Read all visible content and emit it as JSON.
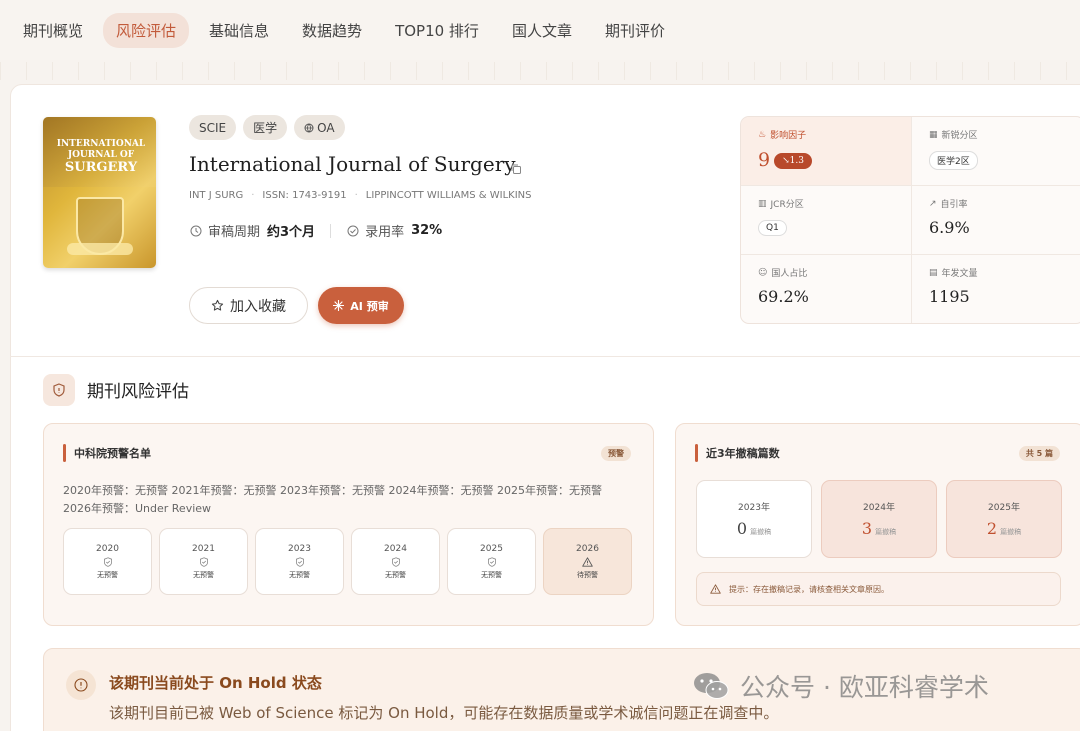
{
  "nav": {
    "tabs": [
      {
        "label": "期刊概览"
      },
      {
        "label": "风险评估"
      },
      {
        "label": "基础信息"
      },
      {
        "label": "数据趋势"
      },
      {
        "label": "TOP10 排行"
      },
      {
        "label": "国人文章"
      },
      {
        "label": "期刊评价"
      }
    ],
    "active_index": 1
  },
  "journal": {
    "cover": {
      "line1": "INTERNATIONAL",
      "line2": "JOURNAL OF",
      "line3": "SURGERY"
    },
    "tags": [
      "SCIE",
      "医学",
      "OA"
    ],
    "title": "International Journal of Surgery",
    "abbr": "INT J SURG",
    "issn": "ISSN: 1743-9191",
    "publisher": "LIPPINCOTT WILLIAMS & WILKINS",
    "review_label": "审稿周期",
    "review_value": "约3个月",
    "accept_label": "录用率",
    "accept_value": "32%",
    "fav_button": "加入收藏",
    "ai_button": "AI 预审"
  },
  "metrics": {
    "impact_label": "影响因子",
    "impact_value": "9",
    "impact_change": "↘1.3",
    "xinrui_label": "新锐分区",
    "xinrui_value": "医学2区",
    "jcr_label": "JCR分区",
    "jcr_value": "Q1",
    "selfcite_label": "自引率",
    "selfcite_value": "6.9%",
    "cn_label": "国人占比",
    "cn_value": "69.2%",
    "annual_label": "年发文量",
    "annual_value": "1195"
  },
  "risk": {
    "section_title": "期刊风险评估",
    "warning_panel": {
      "title": "中科院预警名单",
      "badge": "预警",
      "text_line1": "2020年预警：无预警 2021年预警：无预警 2023年预警：无预警 2024年预警：无预警 2025年预警：无预警",
      "text_line2": "2026年预警：Under Review",
      "years": [
        {
          "year": "2020",
          "status": "无预警"
        },
        {
          "year": "2021",
          "status": "无预警"
        },
        {
          "year": "2023",
          "status": "无预警"
        },
        {
          "year": "2024",
          "status": "无预警"
        },
        {
          "year": "2025",
          "status": "无预警"
        },
        {
          "year": "2026",
          "status": "待预警"
        }
      ]
    },
    "retraction_panel": {
      "title": "近3年撤稿篇数",
      "badge": "共 5 篇",
      "unit": "篇撤稿",
      "years": [
        {
          "year": "2023年",
          "count": "0"
        },
        {
          "year": "2024年",
          "count": "3"
        },
        {
          "year": "2025年",
          "count": "2"
        }
      ],
      "tip": "提示：存在撤稿记录，请核查相关文章原因。"
    }
  },
  "on_hold": {
    "title": "该期刊当前处于 On Hold 状态",
    "desc": "该期刊目前已被 Web of Science 标记为 On Hold，可能存在数据质量或学术诚信问题正在调查中。"
  },
  "watermark": "公众号 · 欧亚科睿学术",
  "colors": {
    "accent": "#c9603d",
    "accent_soft": "#f3e1d8",
    "text": "#2b2b2b"
  }
}
